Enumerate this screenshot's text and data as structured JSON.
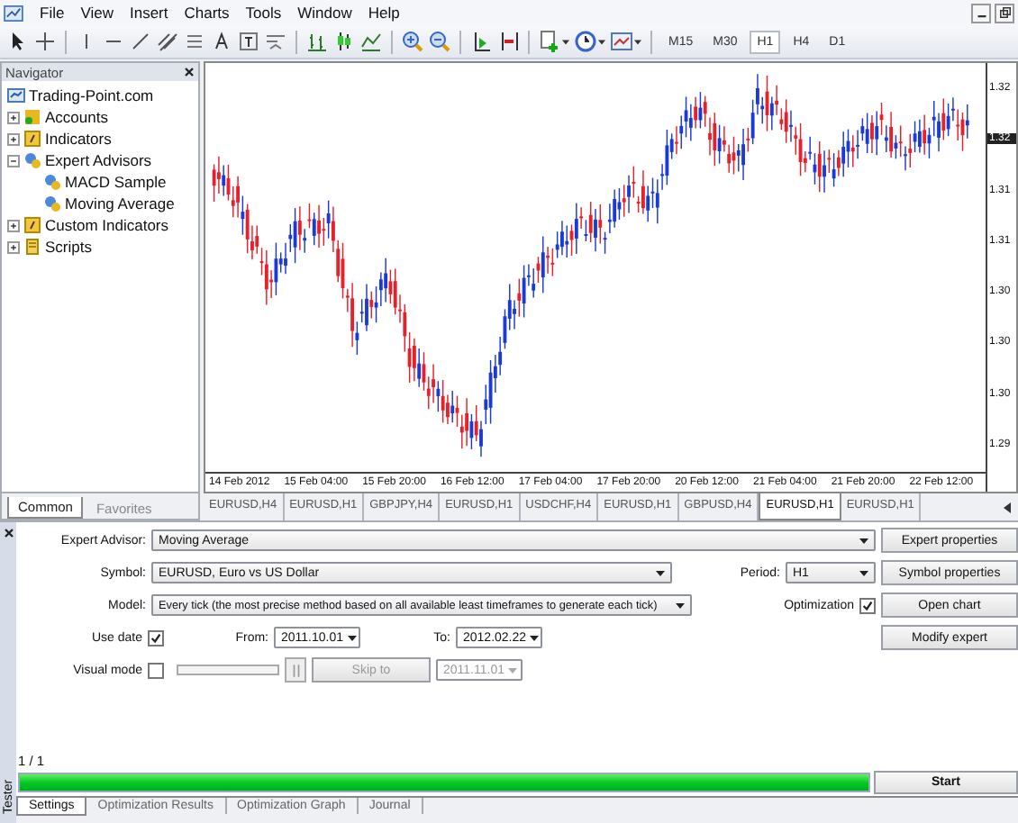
{
  "menu": [
    "File",
    "View",
    "Insert",
    "Charts",
    "Tools",
    "Window",
    "Help"
  ],
  "toolbar": {
    "timeframes": [
      {
        "label": "M15",
        "selected": false
      },
      {
        "label": "M30",
        "selected": false
      },
      {
        "label": "H1",
        "selected": true
      },
      {
        "label": "H4",
        "selected": false
      },
      {
        "label": "D1",
        "selected": false
      }
    ]
  },
  "navigator": {
    "title": "Navigator",
    "root": {
      "label": "Trading-Point.com",
      "children": [
        {
          "label": "Accounts",
          "kind": "accounts",
          "expanded": false
        },
        {
          "label": "Indicators",
          "kind": "indicators",
          "expanded": false
        },
        {
          "label": "Expert Advisors",
          "kind": "experts",
          "expanded": true,
          "children": [
            {
              "label": "MACD Sample",
              "kind": "expert"
            },
            {
              "label": "Moving Average",
              "kind": "expert"
            }
          ]
        },
        {
          "label": "Custom Indicators",
          "kind": "indicators",
          "expanded": false
        },
        {
          "label": "Scripts",
          "kind": "scripts",
          "expanded": false
        }
      ]
    },
    "tabs": [
      {
        "label": "Common",
        "selected": true
      },
      {
        "label": "Favorites",
        "selected": false
      }
    ]
  },
  "chart": {
    "price_labels": [
      "1.32",
      "1.32",
      "1.31",
      "1.31",
      "1.30",
      "1.30",
      "1.30",
      "1.29"
    ],
    "time_labels": [
      "14 Feb 2012",
      "15 Feb 04:00",
      "15 Feb 20:00",
      "16 Feb 12:00",
      "17 Feb 04:00",
      "17 Feb 20:00",
      "20 Feb 12:00",
      "21 Feb 04:00",
      "21 Feb 20:00",
      "22 Feb 12:00"
    ],
    "tabs": [
      {
        "label": "EURUSD,H4",
        "selected": false
      },
      {
        "label": "EURUSD,H1",
        "selected": false
      },
      {
        "label": "GBPJPY,H4",
        "selected": false
      },
      {
        "label": "EURUSD,H1",
        "selected": false
      },
      {
        "label": "USDCHF,H4",
        "selected": false
      },
      {
        "label": "EURUSD,H1",
        "selected": false
      },
      {
        "label": "GBPUSD,H4",
        "selected": false
      },
      {
        "label": "EURUSD,H1",
        "selected": true
      },
      {
        "label": "EURUSD,H1",
        "selected": false
      }
    ]
  },
  "tester": {
    "title": "Tester",
    "expert_advisor": {
      "label": "Expert Advisor:",
      "value": "Moving Average"
    },
    "symbol": {
      "label": "Symbol:",
      "value": "EURUSD, Euro vs US Dollar"
    },
    "period": {
      "label": "Period:",
      "value": "H1"
    },
    "model": {
      "label": "Model:",
      "value": "Every tick (the most precise method based on all available least timeframes to generate each tick)"
    },
    "optimization": {
      "label": "Optimization",
      "checked": true
    },
    "use_date": {
      "label": "Use date",
      "checked": true
    },
    "from": {
      "label": "From:",
      "value": "2011.10.01"
    },
    "to": {
      "label": "To:",
      "value": "2012.02.22"
    },
    "visual_mode": {
      "label": "Visual mode",
      "checked": false
    },
    "skip_to": {
      "button": "Skip to",
      "value": "2011.11.01",
      "disabled": true
    },
    "buttons": [
      "Expert properties",
      "Symbol properties",
      "Open chart",
      "Modify expert"
    ],
    "progress": {
      "text": "1 / 1",
      "level": 1
    },
    "start": "Start",
    "tabs": [
      {
        "label": "Settings",
        "selected": true
      },
      {
        "label": "Optimization Results",
        "selected": false
      },
      {
        "label": "Optimization Graph",
        "selected": false
      },
      {
        "label": "Journal",
        "selected": false
      }
    ]
  }
}
